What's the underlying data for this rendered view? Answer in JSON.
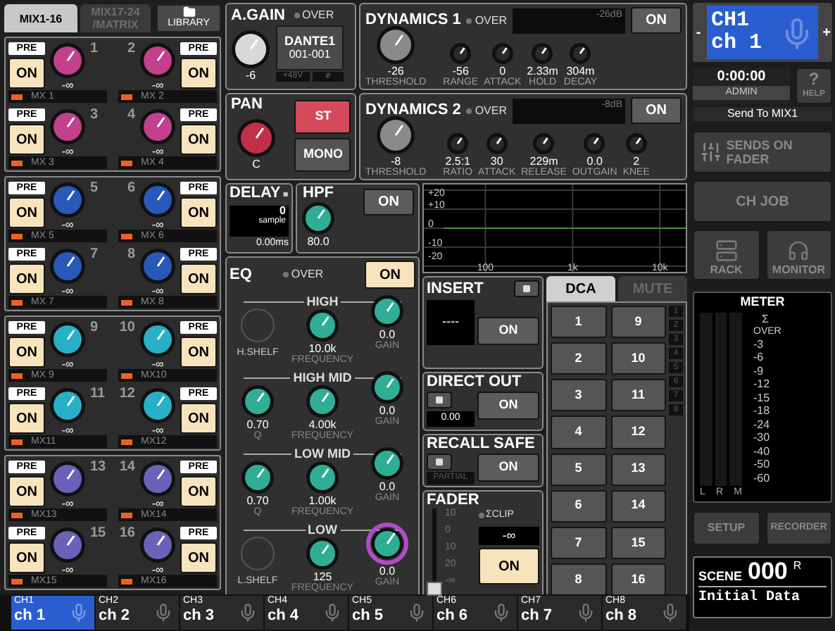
{
  "mix_tabs": [
    {
      "label": "MIX1-16",
      "selected": true
    },
    {
      "label": "MIX17-24 /MATRIX",
      "selected": false
    }
  ],
  "library_button": "LIBRARY",
  "mix_sends": [
    {
      "number": "1",
      "pre": "PRE",
      "on_label": "ON",
      "on": true,
      "value": "-∞",
      "name": "MX 1",
      "color": "#c2408c"
    },
    {
      "number": "2",
      "pre": "PRE",
      "on_label": "ON",
      "on": true,
      "value": "-∞",
      "name": "MX 2",
      "color": "#c2408c"
    },
    {
      "number": "3",
      "pre": "PRE",
      "on_label": "ON",
      "on": true,
      "value": "-∞",
      "name": "MX 3",
      "color": "#c2408c"
    },
    {
      "number": "4",
      "pre": "PRE",
      "on_label": "ON",
      "on": true,
      "value": "-∞",
      "name": "MX 4",
      "color": "#c2408c"
    },
    {
      "number": "5",
      "pre": "PRE",
      "on_label": "ON",
      "on": true,
      "value": "-∞",
      "name": "MX 5",
      "color": "#2858b8"
    },
    {
      "number": "6",
      "pre": "PRE",
      "on_label": "ON",
      "on": true,
      "value": "-∞",
      "name": "MX 6",
      "color": "#2858b8"
    },
    {
      "number": "7",
      "pre": "PRE",
      "on_label": "ON",
      "on": true,
      "value": "-∞",
      "name": "MX 7",
      "color": "#2858b8"
    },
    {
      "number": "8",
      "pre": "PRE",
      "on_label": "ON",
      "on": true,
      "value": "-∞",
      "name": "MX 8",
      "color": "#2858b8"
    },
    {
      "number": "9",
      "pre": "PRE",
      "on_label": "ON",
      "on": true,
      "value": "-∞",
      "name": "MX 9",
      "color": "#28b0c8"
    },
    {
      "number": "10",
      "pre": "PRE",
      "on_label": "ON",
      "on": true,
      "value": "-∞",
      "name": "MX10",
      "color": "#28b0c8"
    },
    {
      "number": "11",
      "pre": "PRE",
      "on_label": "ON",
      "on": true,
      "value": "-∞",
      "name": "MX11",
      "color": "#28b0c8"
    },
    {
      "number": "12",
      "pre": "PRE",
      "on_label": "ON",
      "on": true,
      "value": "-∞",
      "name": "MX12",
      "color": "#28b0c8"
    },
    {
      "number": "13",
      "pre": "PRE",
      "on_label": "ON",
      "on": true,
      "value": "-∞",
      "name": "MX13",
      "color": "#6a62b8"
    },
    {
      "number": "14",
      "pre": "PRE",
      "on_label": "ON",
      "on": true,
      "value": "-∞",
      "name": "MX14",
      "color": "#6a62b8"
    },
    {
      "number": "15",
      "pre": "PRE",
      "on_label": "ON",
      "on": true,
      "value": "-∞",
      "name": "MX15",
      "color": "#6a62b8"
    },
    {
      "number": "16",
      "pre": "PRE",
      "on_label": "ON",
      "on": true,
      "value": "-∞",
      "name": "MX16",
      "color": "#6a62b8"
    }
  ],
  "a_gain": {
    "title": "A.GAIN",
    "over": "OVER",
    "value": "-6",
    "patch": [
      "DANTE1",
      "001-001"
    ],
    "phantom": "+48V",
    "phase": "ø"
  },
  "pan": {
    "title": "PAN",
    "value": "C",
    "buttons": [
      {
        "label": "ST",
        "selected": true
      },
      {
        "label": "MONO",
        "selected": false
      }
    ]
  },
  "dynamics": [
    {
      "title": "DYNAMICS 1",
      "over": "OVER",
      "meter_label": "-26dB",
      "on_label": "ON",
      "on": false,
      "threshold": {
        "value": "-26",
        "label": "THRESHOLD"
      },
      "params": [
        {
          "value": "-56",
          "label": "RANGE"
        },
        {
          "value": "0",
          "label": "ATTACK"
        },
        {
          "value": "2.33m",
          "label": "HOLD"
        },
        {
          "value": "304m",
          "label": "DECAY"
        }
      ]
    },
    {
      "title": "DYNAMICS 2",
      "over": "OVER",
      "meter_label": "-8dB",
      "on_label": "ON",
      "on": false,
      "threshold": {
        "value": "-8",
        "label": "THRESHOLD"
      },
      "params": [
        {
          "value": "2.5:1",
          "label": "RATIO"
        },
        {
          "value": "30",
          "label": "ATTACK"
        },
        {
          "value": "229m",
          "label": "RELEASE"
        },
        {
          "value": "0.0",
          "label": "OUTGAIN"
        },
        {
          "value": "2",
          "label": "KNEE"
        }
      ]
    }
  ],
  "delay": {
    "title": "DELAY",
    "value": "0",
    "unit": "sample",
    "time": "0.00ms"
  },
  "hpf": {
    "title": "HPF",
    "value": "80.0",
    "on_label": "ON",
    "on": false
  },
  "eq_graph": {
    "chart_data": {
      "type": "line",
      "categories": [
        "100",
        "1k",
        "10k"
      ],
      "grid": true,
      "ylim": [
        -20,
        20
      ],
      "series": [
        {
          "color": "#4f8f3a",
          "values": [
            0,
            0,
            0
          ]
        }
      ],
      "yticks": [
        {
          "value": 20,
          "label": "+20"
        },
        {
          "value": 10,
          "label": "+10"
        },
        {
          "value": 0,
          "label": "0"
        },
        {
          "value": -10,
          "label": "-10"
        },
        {
          "value": -20,
          "label": "-20"
        }
      ]
    }
  },
  "eq": {
    "title": "EQ",
    "over": "OVER",
    "on_label": "ON",
    "on": true,
    "bands": [
      {
        "kind": "shelf",
        "name": "HIGH",
        "shelf_label": "H.SHELF",
        "freq": "10.0k",
        "freq_label": "FREQUENCY",
        "gain": "0.0",
        "gain_label": "GAIN",
        "selected": false
      },
      {
        "kind": "peak",
        "name": "HIGH MID",
        "q": "0.70",
        "q_label": "Q",
        "freq": "4.00k",
        "freq_label": "FREQUENCY",
        "gain": "0.0",
        "gain_label": "GAIN",
        "selected": false
      },
      {
        "kind": "peak",
        "name": "LOW MID",
        "q": "0.70",
        "q_label": "Q",
        "freq": "1.00k",
        "freq_label": "FREQUENCY",
        "gain": "0.0",
        "gain_label": "GAIN",
        "selected": false
      },
      {
        "kind": "shelf",
        "name": "LOW",
        "shelf_label": "L.SHELF",
        "freq": "125",
        "freq_label": "FREQUENCY",
        "gain": "0.0",
        "gain_label": "GAIN",
        "selected": true
      }
    ]
  },
  "insert": {
    "title": "INSERT",
    "display": "----",
    "on_label": "ON",
    "on": false
  },
  "direct_out": {
    "title": "DIRECT OUT",
    "value": "0.00",
    "on_label": "ON",
    "on": false
  },
  "recall_safe": {
    "title": "RECALL SAFE",
    "partial": "PARTIAL",
    "on_label": "ON",
    "on": false
  },
  "fader": {
    "title": "FADER",
    "scale": [
      "10",
      "0",
      "10",
      "20",
      "-∞"
    ],
    "clip": "ΣCLIP",
    "value": "-∞",
    "on_label": "ON",
    "on": true,
    "level": 0
  },
  "dca": {
    "tabs": [
      {
        "label": "DCA",
        "selected": true
      },
      {
        "label": "MUTE",
        "selected": false
      }
    ],
    "buttons": [
      "1",
      "9",
      "2",
      "10",
      "3",
      "11",
      "4",
      "12",
      "5",
      "13",
      "6",
      "14",
      "7",
      "15",
      "8",
      "16"
    ],
    "indicators": [
      "1",
      "2",
      "3",
      "4",
      "5",
      "6",
      "7",
      "8"
    ]
  },
  "channel": {
    "minus": "-",
    "id": "CH1",
    "name": "ch 1",
    "plus": "+"
  },
  "time": "0:00:00",
  "user": "ADMIN",
  "help": {
    "mark": "?",
    "label": "HELP"
  },
  "send_to": "Send To MIX1",
  "sends_on_fader": "SENDS ON FADER",
  "ch_job": "CH JOB",
  "rack": "RACK",
  "monitor": "MONITOR",
  "meter": {
    "title": "METER",
    "sigma": "Σ",
    "over": "OVER",
    "scale": [
      "-3",
      "-6",
      "-9",
      "-12",
      "-15",
      "-18",
      "-24",
      "-30",
      "-40",
      "-50",
      "-60"
    ],
    "channels": [
      "L",
      "R",
      "M"
    ]
  },
  "setup": "SETUP",
  "recorder": "RECORDER",
  "scene": {
    "label": "SCENE",
    "number": "000",
    "flag": "R",
    "name": "Initial Data"
  },
  "channel_bar": [
    {
      "id": "CH1",
      "name": "ch 1",
      "selected": true
    },
    {
      "id": "CH2",
      "name": "ch 2",
      "selected": false
    },
    {
      "id": "CH3",
      "name": "ch 3",
      "selected": false
    },
    {
      "id": "CH4",
      "name": "ch 4",
      "selected": false
    },
    {
      "id": "CH5",
      "name": "ch 5",
      "selected": false
    },
    {
      "id": "CH6",
      "name": "ch 6",
      "selected": false
    },
    {
      "id": "CH7",
      "name": "ch 7",
      "selected": false
    },
    {
      "id": "CH8",
      "name": "ch 8",
      "selected": false
    }
  ]
}
